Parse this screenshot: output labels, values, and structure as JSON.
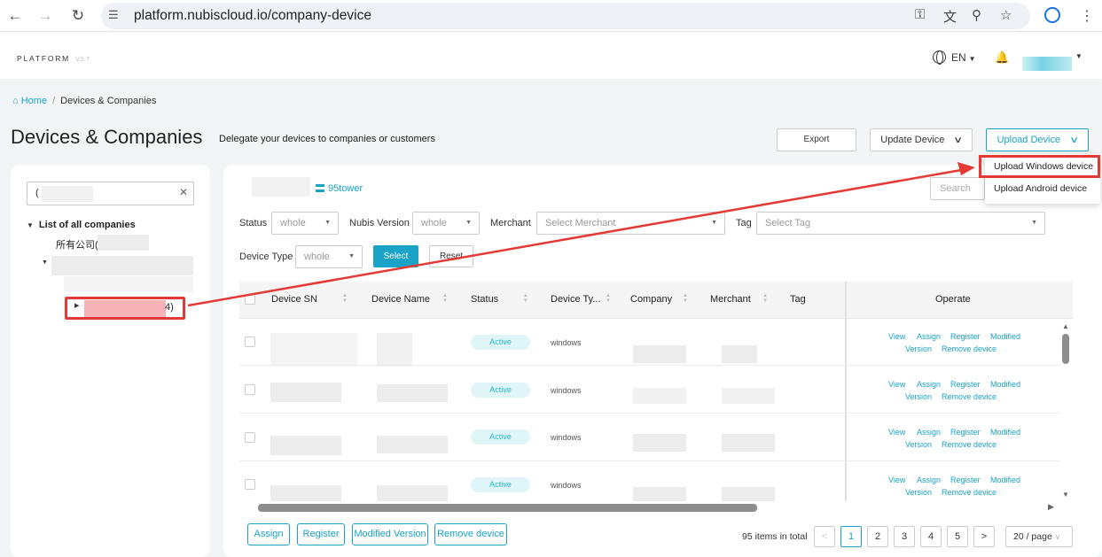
{
  "browser": {
    "url": "platform.nubiscloud.io/company-device"
  },
  "header": {
    "brand": "PLATFORM",
    "version": "V3.7",
    "language": "EN"
  },
  "breadcrumb": {
    "home": "Home",
    "separator": "/",
    "current": "Devices & Companies"
  },
  "page": {
    "title": "Devices & Companies",
    "subtitle": "Delegate your devices to companies or customers"
  },
  "toolbar": {
    "export": "Export",
    "update_device": "Update Device",
    "upload_device": "Upload Device"
  },
  "upload_menu": {
    "items": [
      "Upload Windows device",
      "Upload Android device"
    ]
  },
  "tree": {
    "search_value": "(",
    "root_label": "List of all companies",
    "all_companies": "所有公司(",
    "selected_suffix": "4)"
  },
  "main": {
    "company_name": "95tower",
    "search_placeholder": "Search"
  },
  "filters": {
    "status_label": "Status",
    "status_value": "whole",
    "nubis_label": "Nubis Version",
    "nubis_value": "whole",
    "merchant_label": "Merchant",
    "merchant_placeholder": "Select Merchant",
    "tag_label": "Tag",
    "tag_placeholder": "Select Tag",
    "device_type_label": "Device Type",
    "device_type_value": "whole",
    "select_button": "Select",
    "reset_button": "Reset"
  },
  "table": {
    "columns": [
      "Device SN",
      "Device Name",
      "Status",
      "Device Ty...",
      "Company",
      "Merchant",
      "Tag",
      "Operate"
    ],
    "rows": [
      {
        "status": "Active",
        "type": "windows"
      },
      {
        "status": "Active",
        "type": "windows"
      },
      {
        "status": "Active",
        "type": "windows"
      },
      {
        "status": "Active",
        "type": "windows"
      }
    ],
    "operations": {
      "view": "View",
      "assign": "Assign",
      "register": "Register",
      "modified": "Modified",
      "version": "Version",
      "remove": "Remove device"
    }
  },
  "bulk_actions": {
    "assign": "Assign",
    "register": "Register",
    "modified_version": "Modified Version",
    "remove_device": "Remove device"
  },
  "pagination": {
    "total": "95 items in total",
    "pages": [
      "1",
      "2",
      "3",
      "4",
      "5"
    ],
    "current": "1",
    "per_page": "20 / page"
  }
}
